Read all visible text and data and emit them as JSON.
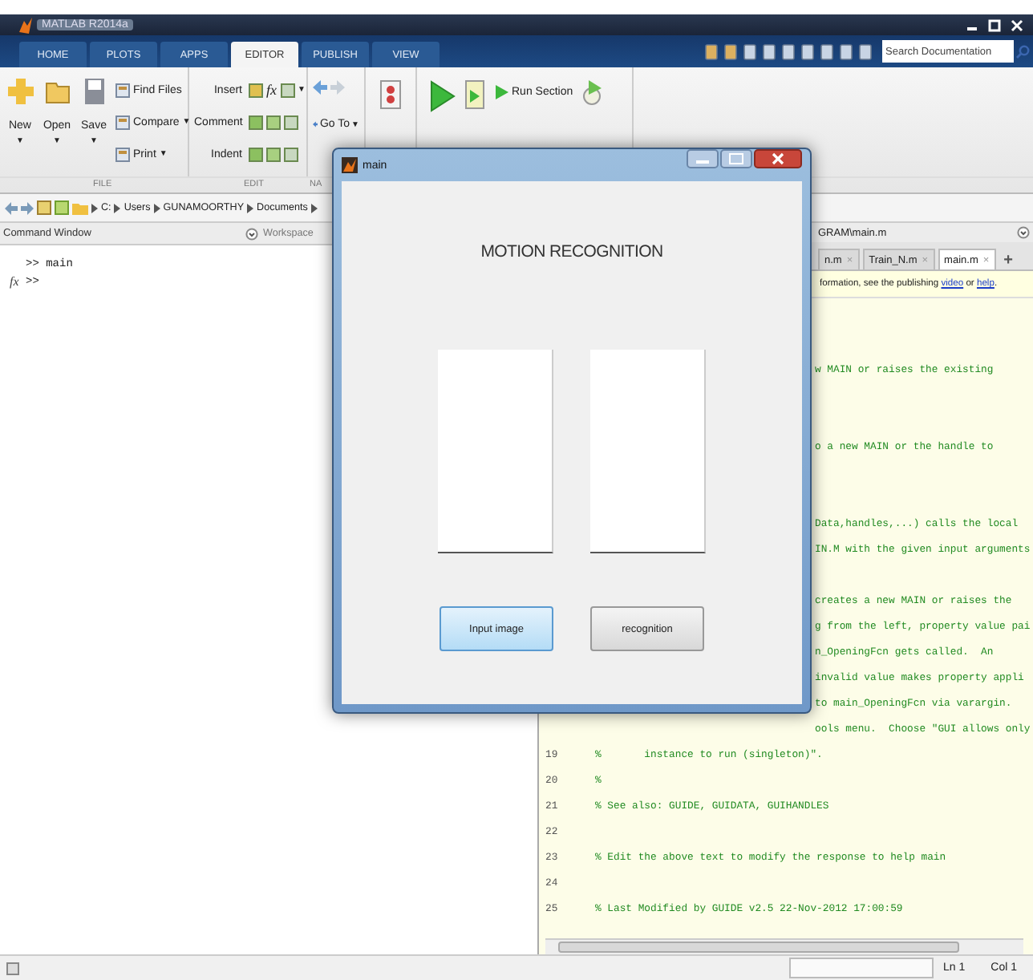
{
  "window": {
    "title": "MATLAB R2014a"
  },
  "tabs": [
    {
      "label": "HOME",
      "selected": false
    },
    {
      "label": "PLOTS",
      "selected": false
    },
    {
      "label": "APPS",
      "selected": false
    },
    {
      "label": "EDITOR",
      "selected": true
    },
    {
      "label": "PUBLISH",
      "selected": false
    },
    {
      "label": "VIEW",
      "selected": false
    }
  ],
  "search": {
    "placeholder": "Search Documentation"
  },
  "toolstrip": {
    "file": {
      "big_buttons": [
        {
          "label": "New",
          "arrow": "▼"
        },
        {
          "label": "Open",
          "arrow": "▼"
        },
        {
          "label": "Save",
          "arrow": "▼"
        }
      ],
      "small_buttons": [
        {
          "label": "Find Files"
        },
        {
          "label": "Compare",
          "arrow": "▼"
        },
        {
          "label": "Print",
          "arrow": "▼"
        }
      ],
      "section": "FILE"
    },
    "edit": {
      "rows": [
        {
          "label": "Insert"
        },
        {
          "label": "Comment"
        },
        {
          "label": "Indent"
        }
      ],
      "fx": "fx",
      "arrow": "▼",
      "section": "EDIT"
    },
    "navigate": {
      "go_to": {
        "label": "Go To",
        "arrow": "▼"
      },
      "section": "NA"
    },
    "run": {
      "run_section": "Run Section"
    }
  },
  "address_bar": {
    "path": [
      "C:",
      "Users",
      "GUNAMOORTHY",
      "Documents"
    ]
  },
  "command_window": {
    "title": "Command Window",
    "workspace_tab": "Workspace",
    "lines": [
      {
        "fx": false,
        "text": ">> main"
      },
      {
        "fx": true,
        "text": ">>"
      }
    ],
    "fx": "fx"
  },
  "editor": {
    "title": "GRAM\\main.m",
    "tabs": [
      {
        "label": "n.m",
        "close": "×",
        "selected": false
      },
      {
        "label": "Train_N.m",
        "close": "×",
        "selected": false
      },
      {
        "label": "main.m",
        "close": "×",
        "selected": true
      }
    ],
    "add": "+",
    "info": [
      {
        "kind": "plain",
        "text": "formation, see the publishing "
      },
      {
        "kind": "link",
        "text": "video"
      },
      {
        "kind": "plain",
        "text": " or "
      },
      {
        "kind": "link",
        "text": "help"
      },
      {
        "kind": "plain",
        "text": "."
      }
    ],
    "lines": [
      {
        "kind": "covered"
      },
      {
        "kind": "covered"
      },
      {
        "kind": "covered",
        "text": "w MAIN or raises the existing"
      },
      {
        "kind": "covered"
      },
      {
        "kind": "covered"
      },
      {
        "kind": "covered",
        "text": "o a new MAIN or the handle to"
      },
      {
        "kind": "covered"
      },
      {
        "kind": "covered"
      },
      {
        "kind": "covered",
        "text": "Data,handles,...) calls the local"
      },
      {
        "kind": "covered",
        "text": "IN.M with the given input arguments"
      },
      {
        "kind": "covered"
      },
      {
        "kind": "covered",
        "text": "creates a new MAIN or raises the"
      },
      {
        "kind": "covered",
        "text": "g from the left, property value pai"
      },
      {
        "kind": "covered",
        "text": "n_OpeningFcn gets called.  An"
      },
      {
        "kind": "covered",
        "text": "invalid value makes property appli"
      },
      {
        "kind": "covered",
        "text": "to main_OpeningFcn via varargin."
      },
      {
        "kind": "covered",
        "text": "ools menu.  Choose \"GUI allows only"
      },
      {
        "kind": "full",
        "number": "19",
        "text": "%       instance to run (singleton)\"."
      },
      {
        "kind": "full",
        "number": "20",
        "text": "%"
      },
      {
        "kind": "full",
        "number": "21",
        "text": "% See also: GUIDE, GUIDATA, GUIHANDLES"
      },
      {
        "kind": "full",
        "number": "22"
      },
      {
        "kind": "full",
        "number": "23",
        "text": "% Edit the above text to modify the response to help main"
      },
      {
        "kind": "full",
        "number": "24"
      },
      {
        "kind": "full",
        "number": "25",
        "text": "% Last Modified by GUIDE v2.5 22-Nov-2012 17:00:59"
      }
    ]
  },
  "dialog": {
    "title": "main",
    "heading": "MOTION RECOGNITION",
    "buttons": [
      {
        "label": "Input image",
        "focused": true
      },
      {
        "label": "recognition",
        "focused": false
      }
    ]
  },
  "status_bar": {
    "line": "Ln 1",
    "column": "Col 1"
  }
}
